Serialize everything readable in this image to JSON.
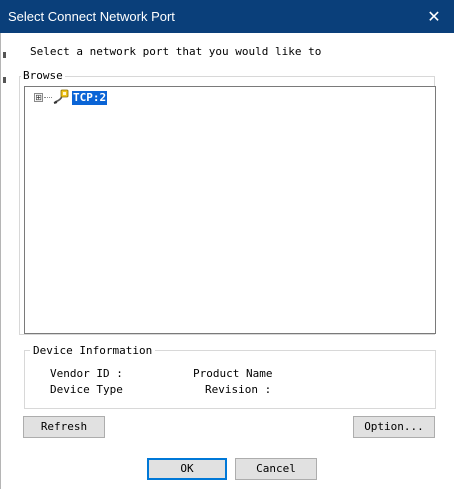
{
  "window": {
    "title": "Select Connect Network Port",
    "close_glyph": "✕"
  },
  "instruction": "Select a network port that you would like to",
  "browse": {
    "caption": "Browse",
    "tree": {
      "expander": "⊞",
      "icon": "network-port-icon",
      "selected_label": "TCP:2"
    }
  },
  "device_info": {
    "caption": "Device Information",
    "vendor_id_label": "Vendor ID :",
    "product_name_label": "Product Name",
    "device_type_label": "Device Type",
    "revision_label": "Revision :"
  },
  "buttons": {
    "refresh": "Refresh",
    "option": "Option...",
    "ok": "OK",
    "cancel": "Cancel"
  },
  "colors": {
    "titlebar": "#0a3f7a",
    "selection": "#0a64d6",
    "button_face": "#e1e1e1",
    "default_button_border": "#0078d7"
  }
}
